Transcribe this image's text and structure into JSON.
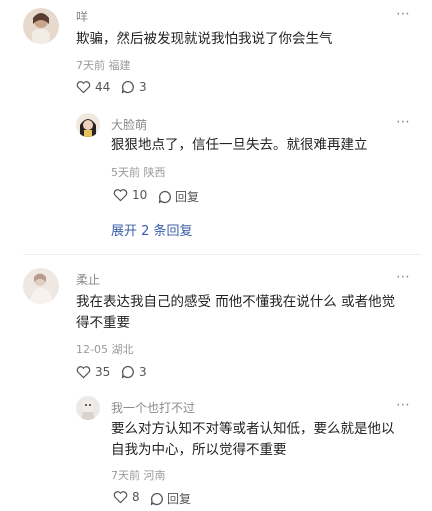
{
  "comments": [
    {
      "name": "咩",
      "text": "欺骗，然后被发现就说我怕我说了你会生气",
      "meta": "7天前 福建",
      "likes": "44",
      "replies": "3",
      "reply": {
        "name": "大脸萌",
        "text": "狠狠地点了，信任一旦失去。就很难再建立",
        "meta": "5天前 陕西",
        "likes": "10",
        "reply_label": "回复"
      },
      "expand_label": "展开 2 条回复"
    },
    {
      "name": "柔止",
      "text_lines": [
        "我在表达我自己的感受 而他不懂我在说什么 或者他觉",
        "得不重要"
      ],
      "meta": "12-05 湖北",
      "likes": "35",
      "replies": "3",
      "reply": {
        "name": "我一个也打不过",
        "text_lines": [
          "要么对方认知不对等或者认知低，要么就是他以",
          "自我为中心，所以觉得不重要"
        ],
        "meta": "7天前 河南",
        "likes": "8",
        "reply_label": "回复"
      }
    }
  ],
  "more_icon": "⋯"
}
